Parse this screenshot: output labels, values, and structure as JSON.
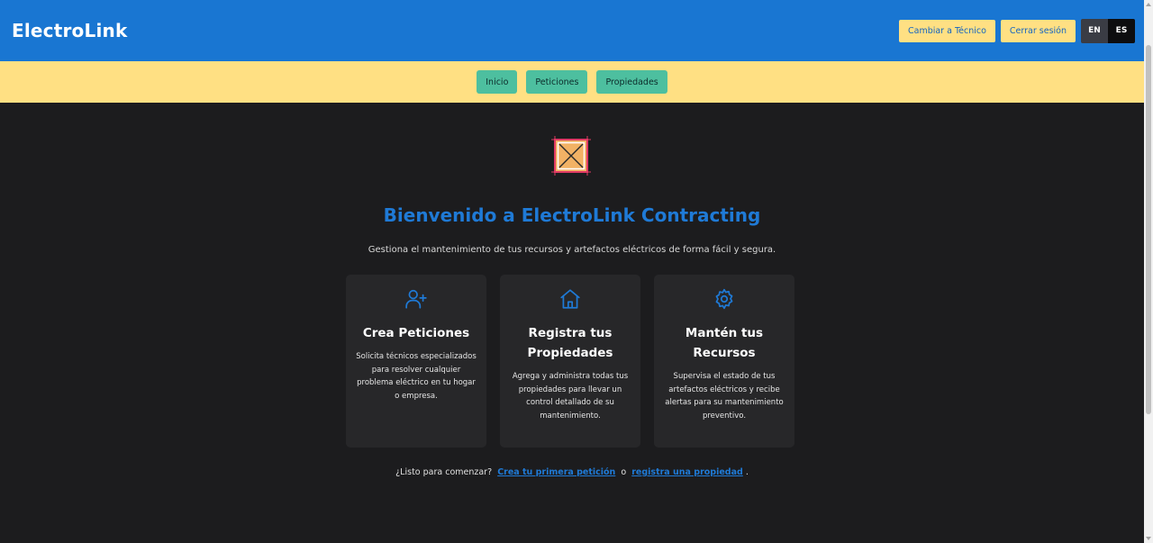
{
  "header": {
    "brand": "ElectroLink",
    "switch_role_label": "Cambiar a Técnico",
    "logout_label": "Cerrar sesión",
    "lang_en": "EN",
    "lang_es": "ES",
    "selected_lang": "ES"
  },
  "nav": {
    "items": [
      {
        "label": "Inicio"
      },
      {
        "label": "Peticiones"
      },
      {
        "label": "Propiedades"
      }
    ]
  },
  "hero": {
    "image_icon": "broken-image-icon",
    "title": "Bienvenido a ElectroLink Contracting",
    "subtitle": "Gestiona el mantenimiento de tus recursos y artefactos eléctricos de forma fácil y segura."
  },
  "cards": [
    {
      "icon": "user-plus-icon",
      "title": "Crea Peticiones",
      "text": "Solicita técnicos especializados para resolver cualquier problema eléctrico en tu hogar o empresa."
    },
    {
      "icon": "home-icon",
      "title": "Registra tus Propiedades",
      "text": "Agrega y administra todas tus propiedades para llevar un control detallado de su mantenimiento."
    },
    {
      "icon": "gear-icon",
      "title": "Mantén tus Recursos",
      "text": "Supervisa el estado de tus artefactos eléctricos y recibe alertas para su mantenimiento preventivo."
    }
  ],
  "cta": {
    "prefix": "¿Listo para comenzar?",
    "link1": "Crea tu primera petición",
    "joiner": "o",
    "link2": "registra una propiedad",
    "suffix": "."
  },
  "colors": {
    "header_bg": "#1976d2",
    "nav_bg": "#ffe083",
    "nav_button": "#4dbf9f",
    "accent": "#1f7ad6",
    "page_bg": "#1c1c1e",
    "card_bg": "#272729"
  }
}
